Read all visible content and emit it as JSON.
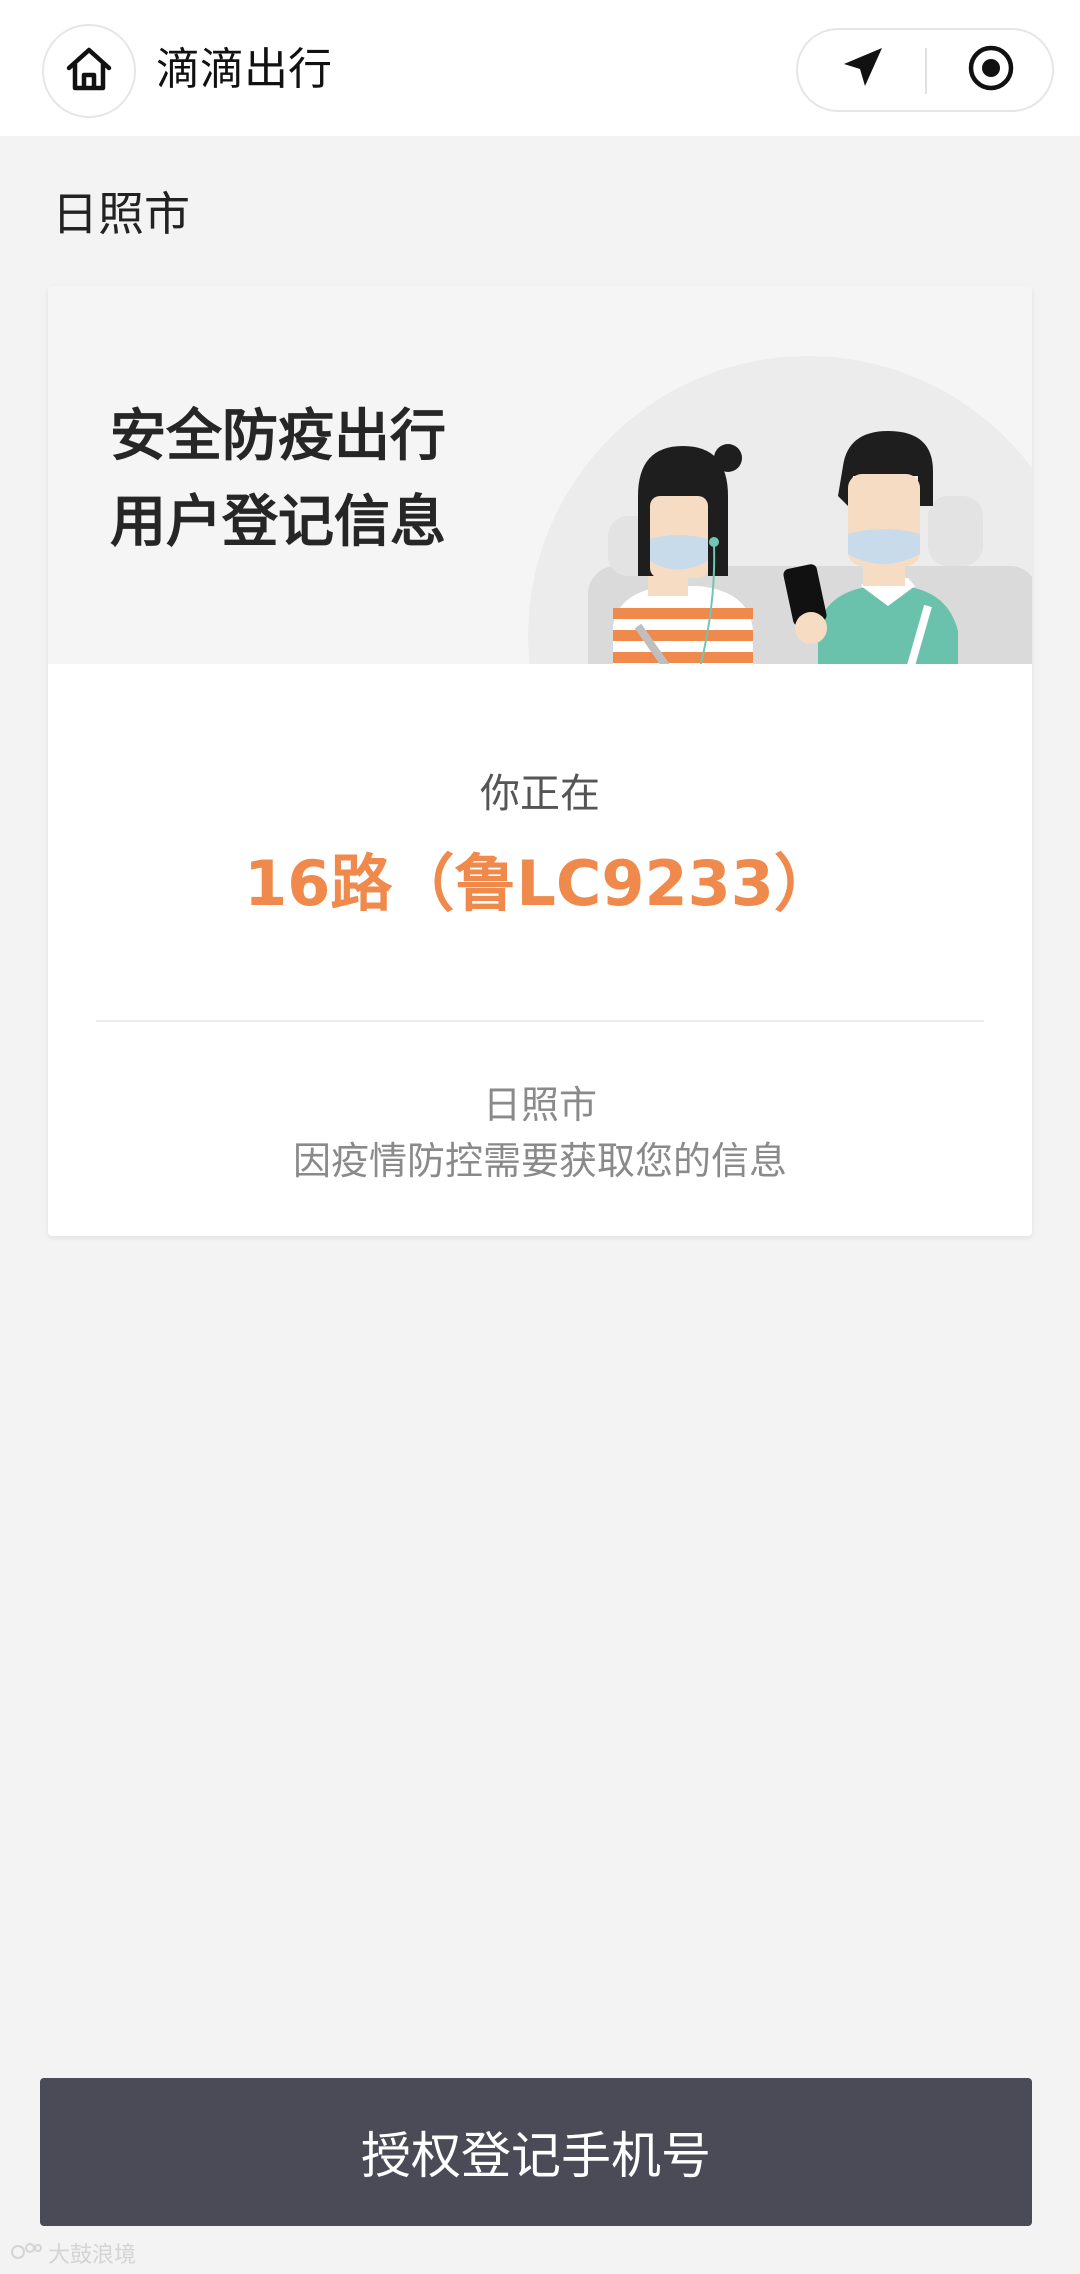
{
  "topbar": {
    "home_icon": "home-icon",
    "title": "滴滴出行",
    "capsule_icons": [
      "navigation-arrow-icon",
      "record-target-icon"
    ]
  },
  "page": {
    "city": "日照市"
  },
  "card": {
    "banner_line1": "安全防疫出行",
    "banner_line2": "用户登记信息",
    "you_are_on": "你正在",
    "bus_line": "16路（鲁LC9233）",
    "info_city": "日照市",
    "info_reason": "因疫情防控需要获取您的信息"
  },
  "actions": {
    "authorize_label": "授权登记手机号"
  },
  "watermark": {
    "text": "大鼓浪境"
  },
  "colors": {
    "accent_orange": "#ef8a4c",
    "button_dark": "#4a4b57",
    "background": "#f3f3f4"
  }
}
